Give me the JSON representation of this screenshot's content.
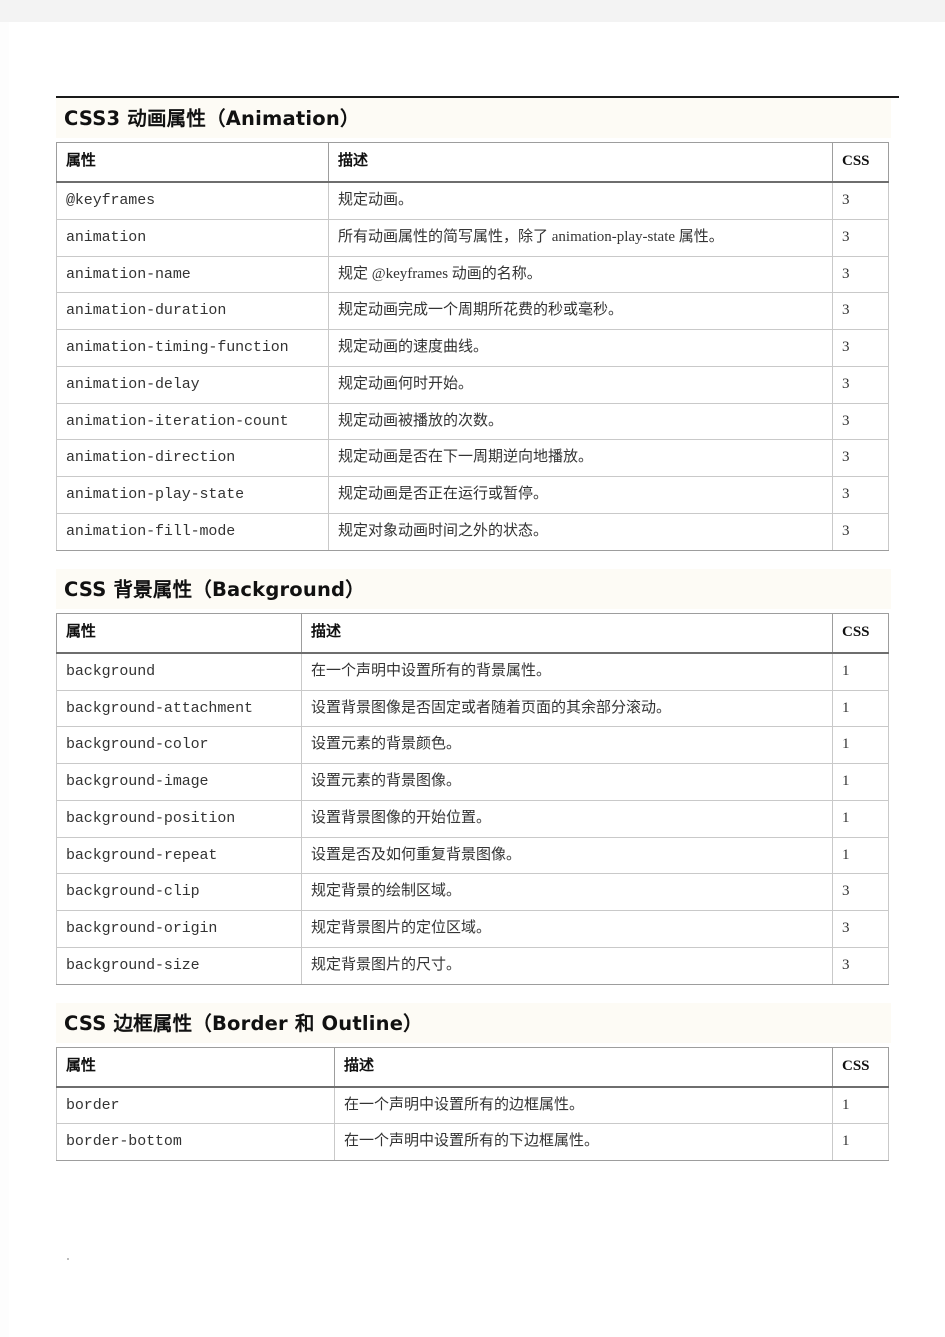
{
  "document": {
    "sections": [
      {
        "id": "animation",
        "title": "CSS3 动画属性（Animation）",
        "columns": [
          "属性",
          "描述",
          "CSS"
        ],
        "rows": [
          {
            "property": "@keyframes",
            "description": "规定动画。",
            "css": "3"
          },
          {
            "property": "animation",
            "description": "所有动画属性的简写属性，除了 animation-play-state 属性。",
            "css": "3"
          },
          {
            "property": "animation-name",
            "description": "规定 @keyframes 动画的名称。",
            "css": "3"
          },
          {
            "property": "animation-duration",
            "description": "规定动画完成一个周期所花费的秒或毫秒。",
            "css": "3"
          },
          {
            "property": "animation-timing-function",
            "description": "规定动画的速度曲线。",
            "css": "3"
          },
          {
            "property": "animation-delay",
            "description": "规定动画何时开始。",
            "css": "3"
          },
          {
            "property": "animation-iteration-count",
            "description": "规定动画被播放的次数。",
            "css": "3"
          },
          {
            "property": "animation-direction",
            "description": "规定动画是否在下一周期逆向地播放。",
            "css": "3"
          },
          {
            "property": "animation-play-state",
            "description": "规定动画是否正在运行或暂停。",
            "css": "3"
          },
          {
            "property": "animation-fill-mode",
            "description": "规定对象动画时间之外的状态。",
            "css": "3"
          }
        ]
      },
      {
        "id": "background",
        "title": "CSS 背景属性（Background）",
        "columns": [
          "属性",
          "描述",
          "CSS"
        ],
        "rows": [
          {
            "property": "background",
            "description": "在一个声明中设置所有的背景属性。",
            "css": "1"
          },
          {
            "property": "background-attachment",
            "description": "设置背景图像是否固定或者随着页面的其余部分滚动。",
            "css": "1"
          },
          {
            "property": "background-color",
            "description": "设置元素的背景颜色。",
            "css": "1"
          },
          {
            "property": "background-image",
            "description": "设置元素的背景图像。",
            "css": "1"
          },
          {
            "property": "background-position",
            "description": "设置背景图像的开始位置。",
            "css": "1"
          },
          {
            "property": "background-repeat",
            "description": "设置是否及如何重复背景图像。",
            "css": "1"
          },
          {
            "property": "background-clip",
            "description": "规定背景的绘制区域。",
            "css": "3"
          },
          {
            "property": "background-origin",
            "description": "规定背景图片的定位区域。",
            "css": "3"
          },
          {
            "property": "background-size",
            "description": "规定背景图片的尺寸。",
            "css": "3"
          }
        ]
      },
      {
        "id": "border",
        "title": "CSS 边框属性（Border 和 Outline）",
        "columns": [
          "属性",
          "描述",
          "CSS"
        ],
        "rows": [
          {
            "property": "border",
            "description": "在一个声明中设置所有的边框属性。",
            "css": "1"
          },
          {
            "property": "border-bottom",
            "description": "在一个声明中设置所有的下边框属性。",
            "css": "1"
          }
        ]
      }
    ]
  },
  "style": {
    "heading_background": "#fdfbf5",
    "rule_color": "#1a1a1a",
    "table_border": "#9d9d9d",
    "top_band": "#f3f3f3"
  }
}
